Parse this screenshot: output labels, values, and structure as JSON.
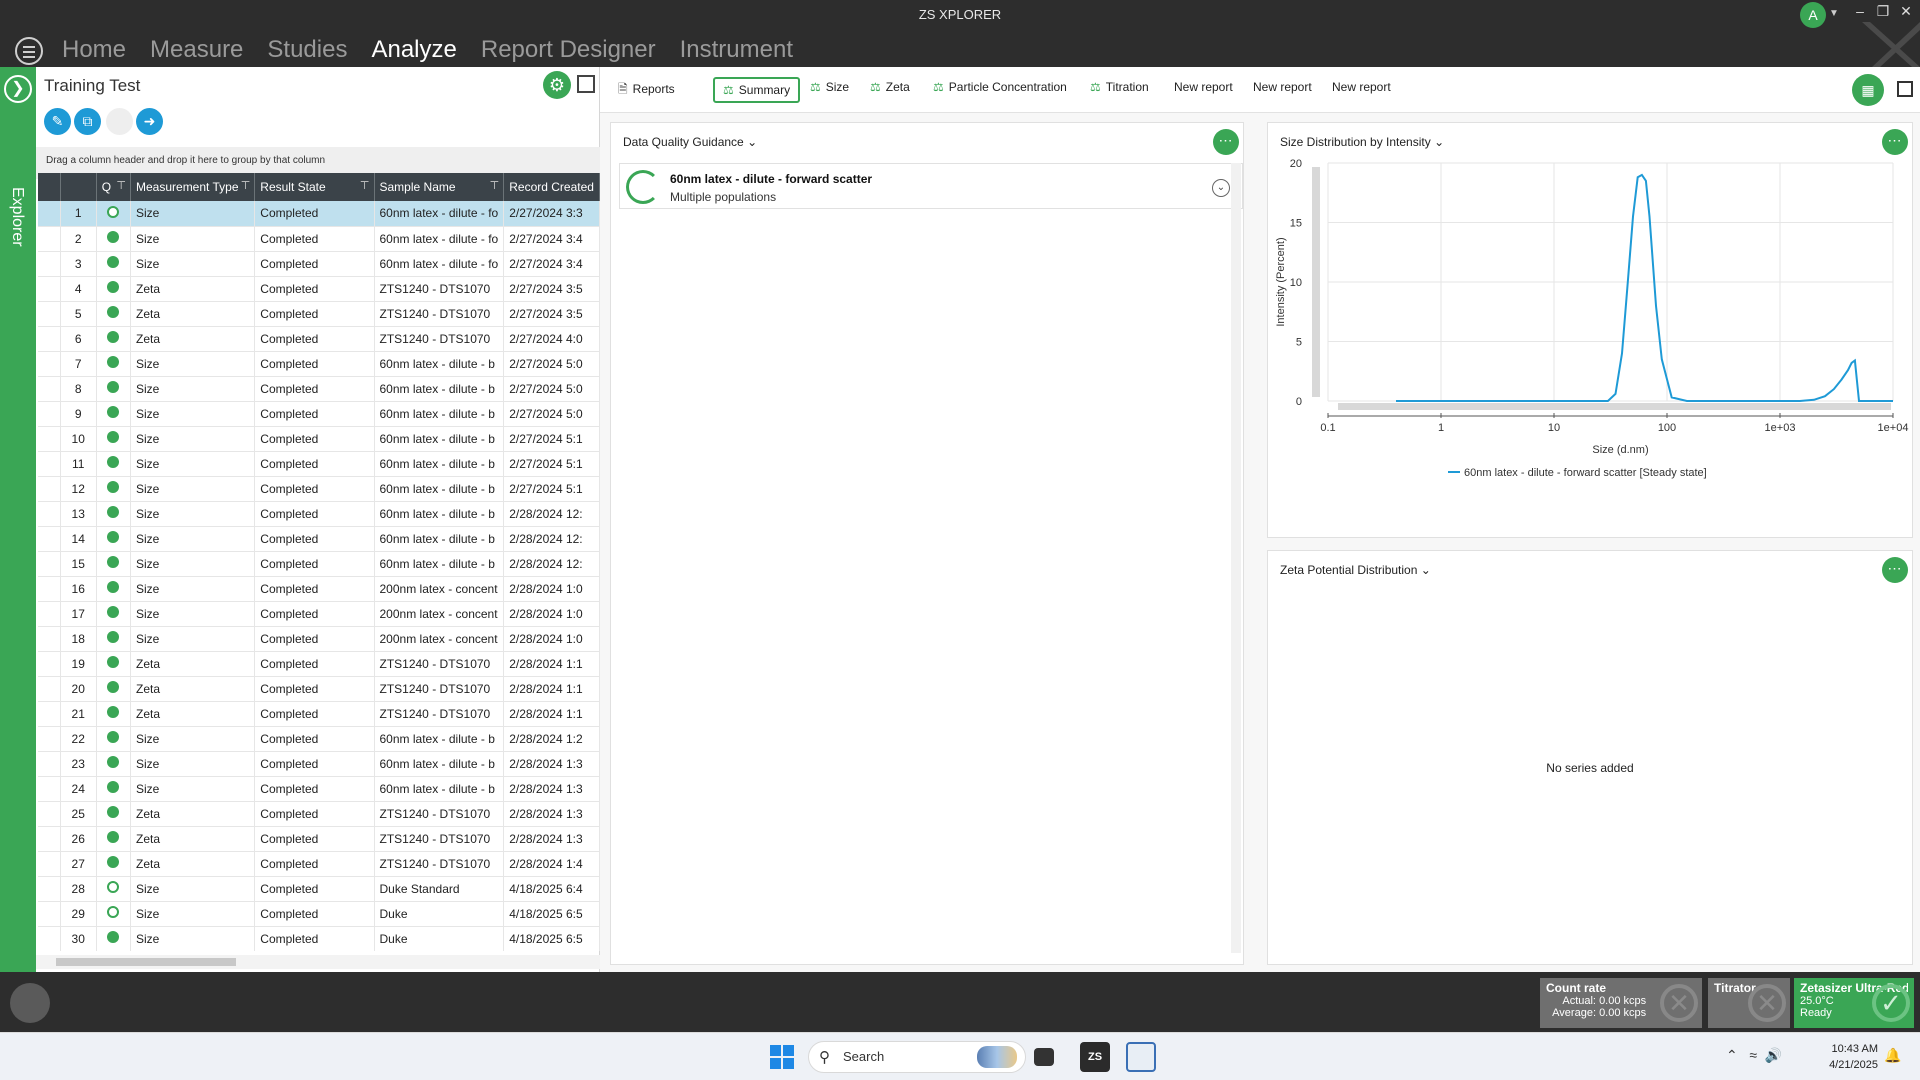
{
  "app": {
    "title": "ZS XPLORER",
    "avatar_initial": "A"
  },
  "nav": {
    "items": [
      "Home",
      "Measure",
      "Studies",
      "Analyze",
      "Report Designer",
      "Instrument"
    ]
  },
  "explorer": {
    "label": "Explorer"
  },
  "left_panel": {
    "title": "Training Test",
    "group_hint": "Drag a column header and drop it here to group by that column",
    "columns": [
      "",
      "Q",
      "Measurement Type",
      "Result State",
      "Sample Name",
      "Record Created"
    ],
    "rows": [
      {
        "n": "1",
        "q": "open",
        "type": "Size",
        "state": "Completed",
        "sample": "60nm latex - dilute - fo",
        "created": "2/27/2024 3:3"
      },
      {
        "n": "2",
        "q": "full",
        "type": "Size",
        "state": "Completed",
        "sample": "60nm latex - dilute - fo",
        "created": "2/27/2024 3:4"
      },
      {
        "n": "3",
        "q": "full",
        "type": "Size",
        "state": "Completed",
        "sample": "60nm latex - dilute - fo",
        "created": "2/27/2024 3:4"
      },
      {
        "n": "4",
        "q": "full",
        "type": "Zeta",
        "state": "Completed",
        "sample": "ZTS1240 - DTS1070",
        "created": "2/27/2024 3:5"
      },
      {
        "n": "5",
        "q": "full",
        "type": "Zeta",
        "state": "Completed",
        "sample": "ZTS1240 - DTS1070",
        "created": "2/27/2024 3:5"
      },
      {
        "n": "6",
        "q": "full",
        "type": "Zeta",
        "state": "Completed",
        "sample": "ZTS1240 - DTS1070",
        "created": "2/27/2024 4:0"
      },
      {
        "n": "7",
        "q": "full",
        "type": "Size",
        "state": "Completed",
        "sample": "60nm latex - dilute - b",
        "created": "2/27/2024 5:0"
      },
      {
        "n": "8",
        "q": "full",
        "type": "Size",
        "state": "Completed",
        "sample": "60nm latex - dilute - b",
        "created": "2/27/2024 5:0"
      },
      {
        "n": "9",
        "q": "full",
        "type": "Size",
        "state": "Completed",
        "sample": "60nm latex - dilute - b",
        "created": "2/27/2024 5:0"
      },
      {
        "n": "10",
        "q": "full",
        "type": "Size",
        "state": "Completed",
        "sample": "60nm latex - dilute - b",
        "created": "2/27/2024 5:1"
      },
      {
        "n": "11",
        "q": "full",
        "type": "Size",
        "state": "Completed",
        "sample": "60nm latex - dilute - b",
        "created": "2/27/2024 5:1"
      },
      {
        "n": "12",
        "q": "full",
        "type": "Size",
        "state": "Completed",
        "sample": "60nm latex - dilute - b",
        "created": "2/27/2024 5:1"
      },
      {
        "n": "13",
        "q": "full",
        "type": "Size",
        "state": "Completed",
        "sample": "60nm latex - dilute - b",
        "created": "2/28/2024 12:"
      },
      {
        "n": "14",
        "q": "full",
        "type": "Size",
        "state": "Completed",
        "sample": "60nm latex - dilute - b",
        "created": "2/28/2024 12:"
      },
      {
        "n": "15",
        "q": "full",
        "type": "Size",
        "state": "Completed",
        "sample": "60nm latex - dilute - b",
        "created": "2/28/2024 12:"
      },
      {
        "n": "16",
        "q": "full",
        "type": "Size",
        "state": "Completed",
        "sample": "200nm latex - concent",
        "created": "2/28/2024 1:0"
      },
      {
        "n": "17",
        "q": "full",
        "type": "Size",
        "state": "Completed",
        "sample": "200nm latex - concent",
        "created": "2/28/2024 1:0"
      },
      {
        "n": "18",
        "q": "full",
        "type": "Size",
        "state": "Completed",
        "sample": "200nm latex - concent",
        "created": "2/28/2024 1:0"
      },
      {
        "n": "19",
        "q": "full",
        "type": "Zeta",
        "state": "Completed",
        "sample": "ZTS1240 - DTS1070",
        "created": "2/28/2024 1:1"
      },
      {
        "n": "20",
        "q": "full",
        "type": "Zeta",
        "state": "Completed",
        "sample": "ZTS1240 - DTS1070",
        "created": "2/28/2024 1:1"
      },
      {
        "n": "21",
        "q": "full",
        "type": "Zeta",
        "state": "Completed",
        "sample": "ZTS1240 - DTS1070",
        "created": "2/28/2024 1:1"
      },
      {
        "n": "22",
        "q": "full",
        "type": "Size",
        "state": "Completed",
        "sample": "60nm latex - dilute - b",
        "created": "2/28/2024 1:2"
      },
      {
        "n": "23",
        "q": "full",
        "type": "Size",
        "state": "Completed",
        "sample": "60nm latex - dilute - b",
        "created": "2/28/2024 1:3"
      },
      {
        "n": "24",
        "q": "full",
        "type": "Size",
        "state": "Completed",
        "sample": "60nm latex - dilute - b",
        "created": "2/28/2024 1:3"
      },
      {
        "n": "25",
        "q": "full",
        "type": "Zeta",
        "state": "Completed",
        "sample": "ZTS1240 - DTS1070",
        "created": "2/28/2024 1:3"
      },
      {
        "n": "26",
        "q": "full",
        "type": "Zeta",
        "state": "Completed",
        "sample": "ZTS1240 - DTS1070",
        "created": "2/28/2024 1:3"
      },
      {
        "n": "27",
        "q": "full",
        "type": "Zeta",
        "state": "Completed",
        "sample": "ZTS1240 - DTS1070",
        "created": "2/28/2024 1:4"
      },
      {
        "n": "28",
        "q": "open",
        "type": "Size",
        "state": "Completed",
        "sample": "Duke Standard",
        "created": "4/18/2025 6:4"
      },
      {
        "n": "29",
        "q": "open",
        "type": "Size",
        "state": "Completed",
        "sample": "Duke",
        "created": "4/18/2025 6:5"
      },
      {
        "n": "30",
        "q": "full",
        "type": "Size",
        "state": "Completed",
        "sample": "Duke",
        "created": "4/18/2025 6:5"
      }
    ]
  },
  "report_tabs": [
    "Reports",
    "Summary",
    "Size",
    "Zeta",
    "Particle Concentration",
    "Titration",
    "New report",
    "New report",
    "New report"
  ],
  "data_quality": {
    "header": "Data Quality Guidance",
    "entry_title": "60nm latex - dilute - forward scatter",
    "entry_subtitle": "Multiple populations"
  },
  "size_chart_card": {
    "header": "Size Distribution by Intensity"
  },
  "zeta_card": {
    "header": "Zeta Potential Distribution",
    "empty_text": "No series added"
  },
  "chart_data": {
    "type": "line",
    "title": "",
    "xlabel": "Size (d.nm)",
    "ylabel": "Intensity (Percent)",
    "xscale": "log",
    "xlim": [
      0.1,
      10000
    ],
    "ylim": [
      0,
      20
    ],
    "x_ticks": [
      "0.1",
      "1",
      "10",
      "100",
      "1e+03",
      "1e+04"
    ],
    "y_ticks": [
      "0",
      "5",
      "10",
      "15",
      "20"
    ],
    "grid": true,
    "legend_position": "bottom",
    "series": [
      {
        "name": "60nm latex - dilute - forward scatter [Steady state]",
        "color": "#1e9ad6",
        "x": [
          0.4,
          10,
          30,
          35,
          40,
          45,
          50,
          55,
          60,
          65,
          70,
          80,
          90,
          110,
          150,
          500,
          1000,
          1500,
          2000,
          2500,
          3000,
          3500,
          4000,
          4300,
          4600,
          5000,
          10000
        ],
        "y": [
          0,
          0,
          0,
          0.6,
          4,
          10,
          15.5,
          18.8,
          19,
          18.5,
          15.5,
          8,
          3.5,
          0.3,
          0,
          0,
          0,
          0,
          0.1,
          0.4,
          1,
          1.8,
          2.6,
          3.2,
          3.4,
          0,
          0
        ]
      }
    ]
  },
  "status": {
    "count_rate": {
      "title": "Count rate",
      "actual_label": "Actual:",
      "actual_value": "0.00 kcps",
      "average_label": "Average:",
      "average_value": "0.00 kcps"
    },
    "titrator": {
      "title": "Titrator"
    },
    "instrument": {
      "title": "Zetasizer Ultra-Red",
      "temperature": "25.0°C",
      "state": "Ready"
    }
  },
  "taskbar": {
    "search_placeholder": "Search",
    "time": "10:43 AM",
    "date": "4/21/2025"
  }
}
